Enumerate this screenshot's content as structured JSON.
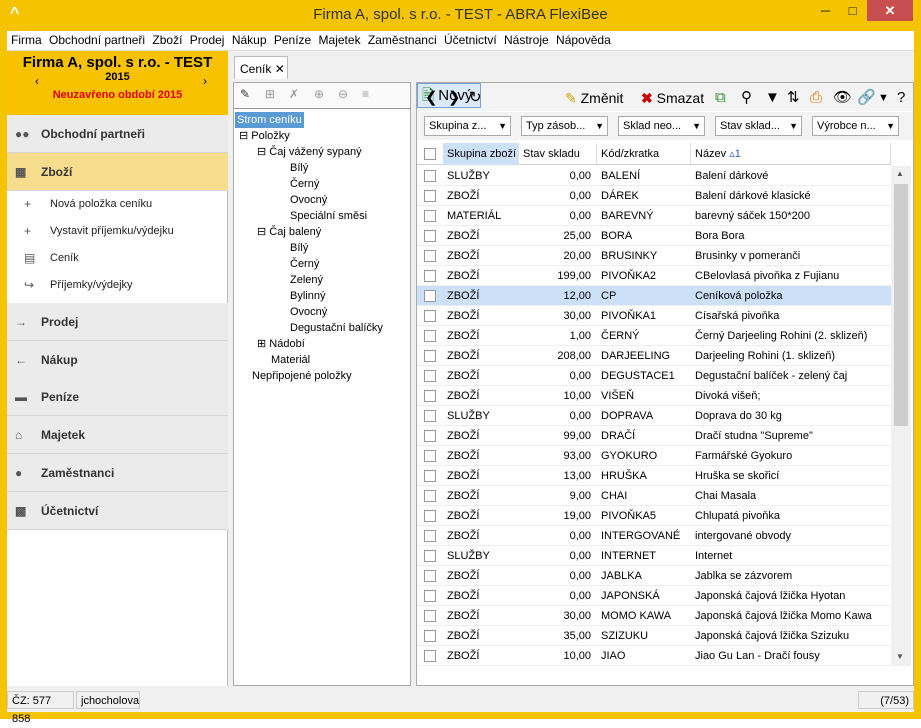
{
  "window": {
    "title": "Firma A, spol. s r.o. - TEST - ABRA FlexiBee",
    "logo": "^",
    "minimize": "─",
    "maximize": "□",
    "close": "✕"
  },
  "menu": [
    "Firma",
    "Obchodní partneři",
    "Zboží",
    "Prodej",
    "Nákup",
    "Peníze",
    "Majetek",
    "Zaměstnanci",
    "Účetnictví",
    "Nástroje",
    "Nápověda"
  ],
  "company": {
    "name": "Firma A, spol. s r.o. - TEST",
    "year": "2015",
    "prev": "‹",
    "next": "›",
    "status": "Neuzavřeno období 2015"
  },
  "nav": {
    "partners": "Obchodní partneři",
    "goods": "Zboží",
    "sub": {
      "new_item": "Nová položka ceníku",
      "issue_receipt": "Vystavit příjemku/výdejku",
      "pricelist": "Ceník",
      "receipts": "Příjemky/výdejky"
    },
    "sales": "Prodej",
    "purchase": "Nákup",
    "money": "Peníze",
    "assets": "Majetek",
    "employees": "Zaměstnanci",
    "accounting": "Účetnictví"
  },
  "tab": {
    "label": "Ceník",
    "close": "✕"
  },
  "tree": {
    "root": "Strom ceníku",
    "items": "Položky",
    "loose_tea": "Čaj vážený sypaný",
    "loose_children": [
      "Bílý",
      "Černý",
      "Ovocný",
      "Speciální směsi"
    ],
    "packed_tea": "Čaj balený",
    "packed_children": [
      "Bílý",
      "Černý",
      "Zelený",
      "Bylinný",
      "Ovocný",
      "Degustační balíčky"
    ],
    "dishes": "Nádobí",
    "material": "Materiál",
    "unattached": "Nepřipojené položky"
  },
  "toolbar": {
    "new": "Nový",
    "edit": "Změnit",
    "delete": "Smazat"
  },
  "filters": [
    "Skupina z...",
    "Typ zásob...",
    "Sklad neo...",
    "Stav sklad...",
    "Výrobce n..."
  ],
  "columns": {
    "group": "Skupina zboží",
    "stock": "Stav skladu",
    "code": "Kód/zkratka",
    "name": "Název",
    "sort": "▵1"
  },
  "rows": [
    {
      "g": "SLUŽBY",
      "s": "0,00",
      "c": "BALENÍ",
      "n": "Balení dárkové"
    },
    {
      "g": "ZBOŽÍ",
      "s": "0,00",
      "c": "DÁREK",
      "n": "Balení dárkové klasické"
    },
    {
      "g": "MATERIÁL",
      "s": "0,00",
      "c": "BAREVNÝ",
      "n": "barevný sáček 150*200"
    },
    {
      "g": "ZBOŽÍ",
      "s": "25,00",
      "c": "BORA",
      "n": "Bora Bora"
    },
    {
      "g": "ZBOŽÍ",
      "s": "20,00",
      "c": "BRUSINKY",
      "n": "Brusinky v pomeranči"
    },
    {
      "g": "ZBOŽÍ",
      "s": "199,00",
      "c": "PIVOŇKA2",
      "n": "CBelovlasá pivoňka z Fujianu"
    },
    {
      "g": "ZBOŽÍ",
      "s": "12,00",
      "c": "CP",
      "n": "Ceníková položka"
    },
    {
      "g": "ZBOŽÍ",
      "s": "30,00",
      "c": "PIVOŇKA1",
      "n": "Císařská pivoňka"
    },
    {
      "g": "ZBOŽÍ",
      "s": "1,00",
      "c": "ČERNÝ",
      "n": "Černý Darjeeling Rohini (2. sklizeň)"
    },
    {
      "g": "ZBOŽÍ",
      "s": "208,00",
      "c": "DARJEELING",
      "n": "Darjeeling Rohini (1. sklizeň)"
    },
    {
      "g": "ZBOŽÍ",
      "s": "0,00",
      "c": "DEGUSTACE1",
      "n": "Degustační balíček - zelený čaj"
    },
    {
      "g": "ZBOŽÍ",
      "s": "10,00",
      "c": "VIŠEŇ",
      "n": "Divoká višeň;"
    },
    {
      "g": "SLUŽBY",
      "s": "0,00",
      "c": "DOPRAVA",
      "n": "Doprava do 30 kg"
    },
    {
      "g": "ZBOŽÍ",
      "s": "99,00",
      "c": "DRAČÍ",
      "n": "Dračí studna \"Supreme\""
    },
    {
      "g": "ZBOŽÍ",
      "s": "93,00",
      "c": "GYOKURO",
      "n": "Farmářské Gyokuro"
    },
    {
      "g": "ZBOŽÍ",
      "s": "13,00",
      "c": "HRUŠKA",
      "n": "Hruška se skořicí"
    },
    {
      "g": "ZBOŽÍ",
      "s": "9,00",
      "c": "CHAI",
      "n": "Chai Masala"
    },
    {
      "g": "ZBOŽÍ",
      "s": "19,00",
      "c": "PIVOŇKA5",
      "n": "Chlupatá pivoňka"
    },
    {
      "g": "ZBOŽÍ",
      "s": "0,00",
      "c": "INTERGOVANÉ",
      "n": "intergované obvody"
    },
    {
      "g": "SLUŽBY",
      "s": "0,00",
      "c": "INTERNET",
      "n": "Internet"
    },
    {
      "g": "ZBOŽÍ",
      "s": "0,00",
      "c": "JABLKA",
      "n": "Jablka se zázvorem"
    },
    {
      "g": "ZBOŽÍ",
      "s": "0,00",
      "c": "JAPONSKÁ",
      "n": "Japonská čajová lžička Hyotan"
    },
    {
      "g": "ZBOŽÍ",
      "s": "30,00",
      "c": "MOMO KAWA",
      "n": "Japonská čajová lžička Momo Kawa"
    },
    {
      "g": "ZBOŽÍ",
      "s": "35,00",
      "c": "SZIZUKU",
      "n": "Japonská čajová lžička Szizuku"
    },
    {
      "g": "ZBOŽÍ",
      "s": "10,00",
      "c": "JIAO",
      "n": "Jiao Gu Lan - Dračí fousy"
    }
  ],
  "selected_row": 6,
  "status": {
    "id": "ČZ: 577 858",
    "user": "jchocholova",
    "count": "(7/53)"
  }
}
